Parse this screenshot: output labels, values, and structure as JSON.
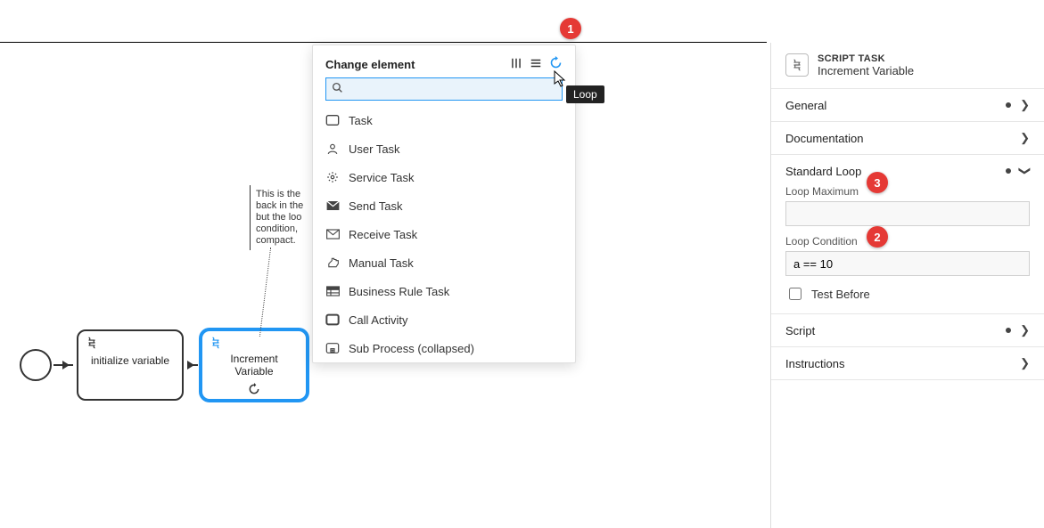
{
  "canvas": {
    "tasks": {
      "init": "initialize variable",
      "incr": "Increment\nVariable"
    },
    "annotation": "This is the\nback in the\nbut the loo\ncondition, \ncompact."
  },
  "popup": {
    "title": "Change element",
    "search_placeholder": "",
    "items": [
      {
        "icon": "task",
        "label": "Task"
      },
      {
        "icon": "user",
        "label": "User Task"
      },
      {
        "icon": "service",
        "label": "Service Task"
      },
      {
        "icon": "send",
        "label": "Send Task"
      },
      {
        "icon": "receive",
        "label": "Receive Task"
      },
      {
        "icon": "manual",
        "label": "Manual Task"
      },
      {
        "icon": "rules",
        "label": "Business Rule Task"
      },
      {
        "icon": "call",
        "label": "Call Activity"
      },
      {
        "icon": "sub",
        "label": "Sub Process (collapsed)"
      }
    ]
  },
  "tooltip": "Loop",
  "callouts": [
    "1",
    "2",
    "3"
  ],
  "panel": {
    "type": "SCRIPT TASK",
    "name": "Increment Variable",
    "sections": {
      "general": "General",
      "documentation": "Documentation",
      "loop": "Standard Loop",
      "script": "Script",
      "instructions": "Instructions"
    },
    "loopMaximumLabel": "Loop Maximum",
    "loopMaximumValue": "",
    "loopConditionLabel": "Loop Condition",
    "loopConditionValue": "a == 10",
    "testBeforeLabel": "Test Before"
  }
}
